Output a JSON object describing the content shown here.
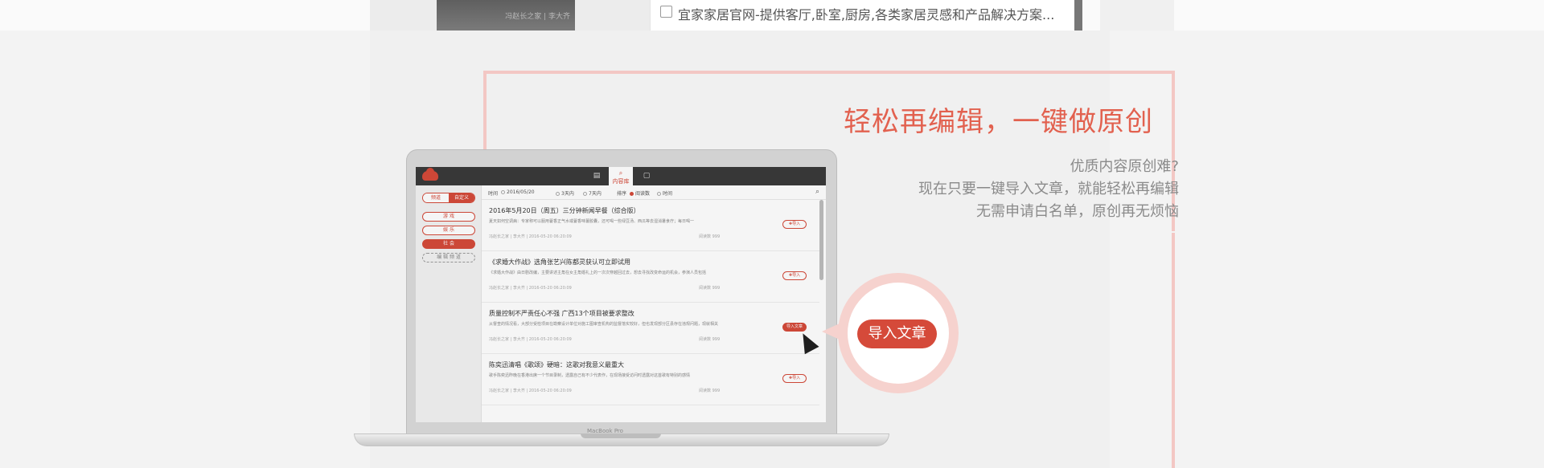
{
  "top_strip": {
    "thumb_caption": "冯赵长之家 | 李大齐",
    "result_text": "宜家家居官网-提供客厅,卧室,厨房,各类家居灵感和产品解决方案..."
  },
  "feature": {
    "headline": "轻松再编辑，一键做原创",
    "lines": [
      "优质内容原创难?",
      "现在只要一键导入文章，就能轻松再编辑",
      "无需申请白名单，原创再无烦恼"
    ],
    "callout_button": "导入文章",
    "brand_color": "#e2614f"
  },
  "app": {
    "tabs": [
      "▤",
      "内容库",
      "▢"
    ],
    "segment": [
      "频道",
      "自定义"
    ],
    "categories": [
      "游 戏",
      "娱 乐",
      "社 会"
    ],
    "edit_channels": "编 辑 频 道",
    "filter": {
      "time_label": "时间",
      "date": "2016/05/20",
      "opt1": "3天内",
      "opt2": "7天内",
      "sort_label": "排序",
      "sort1": "阅读数",
      "sort2": "时间"
    },
    "articles": [
      {
        "title": "2016年5月20日（周五）三分钟新闻早餐（综合版）",
        "summary": "夏天如何空调病：专家称可以服用藿香正气水或藿香味薯胶囊，还可喝一些绿豆汤、西瓜等去湿消暑食疗；每日喝一",
        "meta": "冯赵长之家 | 李大齐 | 2016-05-20 06:20:09",
        "reads": "阅读数 999",
        "button": "✚导入"
      },
      {
        "title": "《求婚大作战》选角张艺兴陈都灵获认可立即试用",
        "summary": "《求婚大作战》由日剧改编，主要讲述主角在女主角婚礼上的一次次穿越回过去，想去寻找改变命运的机会，参演人员包括",
        "meta": "冯赵长之家 | 李大齐 | 2016-05-20 06:20:09",
        "reads": "阅读数 999",
        "button": "✚导入"
      },
      {
        "title": "质量控制不严责任心不强 广西13个项目被要求整改",
        "summary": "从督查的情况看，大部分受检项目在勘察设计单位对施工图审查机构的监督落实较好，但也发现部分区县存在违规问题，现就相关",
        "meta": "冯赵长之家 | 李大齐 | 2016-05-20 06:20:09",
        "reads": "阅读数 999",
        "button": "导入文章"
      },
      {
        "title": "陈奕迅清唱《歌颂》硬暗：这歌对我意义最重大",
        "summary": "歌手陈奕迅昨晚在香港出席一个节目录制，透露自己有不少代表作，在现场接受访问时透露对这首歌有特别的感情",
        "meta": "冯赵长之家 | 李大齐 | 2016-05-20 06:20:09",
        "reads": "阅读数 999",
        "button": "✚导入"
      }
    ],
    "laptop_brand": "MacBook Pro"
  }
}
